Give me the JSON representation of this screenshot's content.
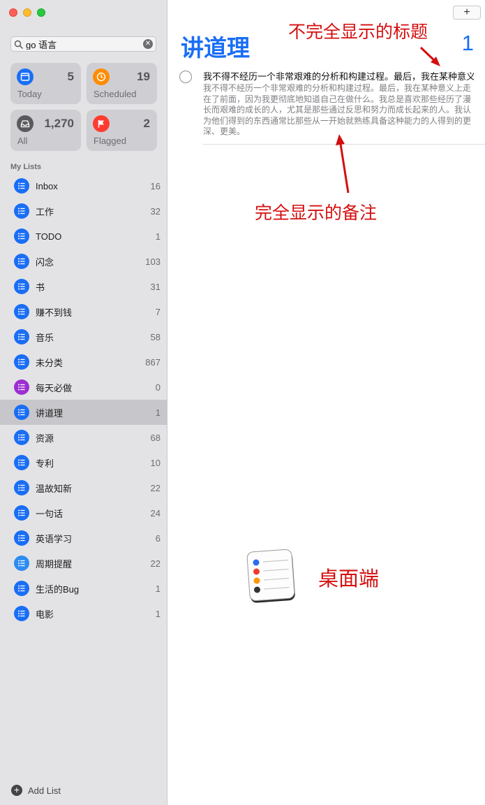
{
  "window": {
    "close_icon": "close",
    "minimize_icon": "minimize",
    "zoom_icon": "zoom"
  },
  "search": {
    "value": "go 语言",
    "placeholder": ""
  },
  "smart_lists": [
    {
      "label": "Today",
      "count": "5",
      "color": "#1a6ef5",
      "icon": "calendar-icon"
    },
    {
      "label": "Scheduled",
      "count": "19",
      "color": "#ff8c00",
      "icon": "clock-icon"
    },
    {
      "label": "All",
      "count": "1,270",
      "color": "#5a5a5e",
      "icon": "tray-icon"
    },
    {
      "label": "Flagged",
      "count": "2",
      "color": "#ff3b30",
      "icon": "flag-icon"
    }
  ],
  "my_lists_label": "My Lists",
  "lists": [
    {
      "name": "Inbox",
      "count": "16",
      "color": "#1a6ef5"
    },
    {
      "name": "工作",
      "count": "32",
      "color": "#1a6ef5"
    },
    {
      "name": "TODO",
      "count": "1",
      "color": "#1a6ef5"
    },
    {
      "name": "闪念",
      "count": "103",
      "color": "#1a6ef5"
    },
    {
      "name": "书",
      "count": "31",
      "color": "#1a6ef5"
    },
    {
      "name": "赚不到钱",
      "count": "7",
      "color": "#1a6ef5"
    },
    {
      "name": "音乐",
      "count": "58",
      "color": "#1a6ef5"
    },
    {
      "name": "未分类",
      "count": "867",
      "color": "#1a6ef5"
    },
    {
      "name": "每天必做",
      "count": "0",
      "color": "#9b2fd0"
    },
    {
      "name": "讲道理",
      "count": "1",
      "color": "#1a6ef5",
      "selected": true
    },
    {
      "name": "资源",
      "count": "68",
      "color": "#1a6ef5"
    },
    {
      "name": "专利",
      "count": "10",
      "color": "#1a6ef5"
    },
    {
      "name": "温故知新",
      "count": "22",
      "color": "#1a6ef5"
    },
    {
      "name": "一句话",
      "count": "24",
      "color": "#1a6ef5"
    },
    {
      "name": "英语学习",
      "count": "6",
      "color": "#1a6ef5"
    },
    {
      "name": "周期提醒",
      "count": "22",
      "color": "#2e8cf0"
    },
    {
      "name": "生活的Bug",
      "count": "1",
      "color": "#1a6ef5"
    },
    {
      "name": "电影",
      "count": "1",
      "color": "#1a6ef5"
    }
  ],
  "add_list_label": "Add List",
  "main": {
    "add_button": "+",
    "title": "讲道理",
    "total": "1",
    "reminder": {
      "title": "我不得不经历一个非常艰难的分析和构建过程。最后，我在某种意义上走在了前面，因为我更彻底地知道自己在做什么。",
      "notes": "我不得不经历一个非常艰难的分析和构建过程。最后，我在某种意义上走在了前面，因为我更彻底地知道自己在做什么。我总是喜欢那些经历了漫长而艰难的成长的人，尤其是那些通过反思和努力而成长起来的人。我认为他们得到的东西通常比那些从一开始就熟练具备这种能力的人得到的更深、更美。"
    }
  },
  "annotations": {
    "title_note": "不完全显示的标题",
    "notes_note": "完全显示的备注",
    "desktop_note": "桌面端"
  }
}
